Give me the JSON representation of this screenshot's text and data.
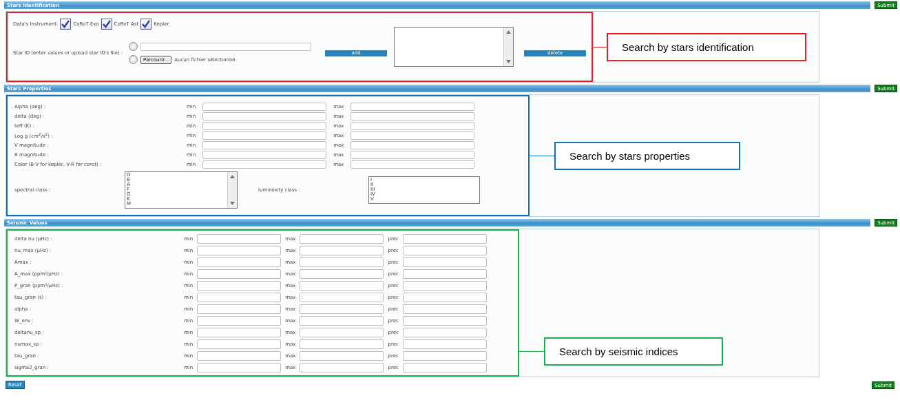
{
  "identification": {
    "title": "Stars Identification",
    "submit": "Submit",
    "instrument_label": "Data's Instrument:",
    "instruments": [
      {
        "label": "CoRoT Exo",
        "checked": true
      },
      {
        "label": "CoRoT Ast",
        "checked": true
      },
      {
        "label": "Kepler",
        "checked": true
      }
    ],
    "star_id_label": "Star ID (enter values or upload star ID's file) :",
    "options": [
      {
        "kind": "text",
        "selected": false
      },
      {
        "kind": "file",
        "selected": false,
        "browse": "Parcourir...",
        "file_status": "Aucun fichier sélectionné."
      }
    ],
    "add": "add",
    "delete": "delete",
    "annotation": {
      "text": "Search by stars identification",
      "color": "#ee1c1c"
    }
  },
  "properties": {
    "title": "Stars Properties",
    "submit": "Submit",
    "rows": [
      {
        "label": "Alpha (deg) :",
        "min": "min",
        "max": "max"
      },
      {
        "label": "delta (deg) :",
        "min": "min",
        "max": "max"
      },
      {
        "label": "teff (K) :",
        "min": "min",
        "max": "max"
      },
      {
        "label": "Log g (cm$^{2}$/s$^{2}$) :",
        "min": "min",
        "max": "max"
      },
      {
        "label": "V magnitude :",
        "min": "min",
        "max": "max"
      },
      {
        "label": "R magnitude :",
        "min": "min",
        "max": "max"
      },
      {
        "label": "Color (B-V for kepler, V-R for corot) :",
        "min": "min",
        "max": "max"
      }
    ],
    "spectral_label": "spectral class :",
    "spectral_options": [
      "O",
      "B",
      "A",
      "F",
      "G",
      "K",
      "M"
    ],
    "luminosity_label": "luminosity class :",
    "luminosity_options": [
      "I",
      "II",
      "III",
      "IV",
      "V"
    ],
    "annotation": {
      "text": "Search by stars properties",
      "color": "#1070c0"
    }
  },
  "seismic": {
    "title": "Seismic Values",
    "submit": "Submit",
    "rows": [
      {
        "label": "delta nu (µHz) :",
        "min": "min",
        "max": "max",
        "prec": "prec"
      },
      {
        "label": "nu_max (µHz) :",
        "min": "min",
        "max": "max",
        "prec": "prec"
      },
      {
        "label": "Amax :",
        "min": "min",
        "max": "max",
        "prec": "prec"
      },
      {
        "label": "A_max (ppm²/µHz) :",
        "min": "min",
        "max": "max",
        "prec": "prec"
      },
      {
        "label": "P_gran (ppm²/µHz) :",
        "min": "min",
        "max": "max",
        "prec": "prec"
      },
      {
        "label": "tau_gran (s) :",
        "min": "min",
        "max": "max",
        "prec": "prec"
      },
      {
        "label": "alpha :",
        "min": "min",
        "max": "max",
        "prec": "prec"
      },
      {
        "label": "W_env :",
        "min": "min",
        "max": "max",
        "prec": "prec"
      },
      {
        "label": "deltanu_sp :",
        "min": "min",
        "max": "max",
        "prec": "prec"
      },
      {
        "label": "numax_sp :",
        "min": "min",
        "max": "max",
        "prec": "prec"
      },
      {
        "label": "tau_gran :",
        "min": "min",
        "max": "max",
        "prec": "prec"
      },
      {
        "label": "sigma2_gran :",
        "min": "min",
        "max": "max",
        "prec": "prec"
      }
    ],
    "annotation": {
      "text": "Search by seismic indices",
      "color": "#1db04c"
    }
  },
  "footer": {
    "reset": "Reset",
    "submit": "Submit"
  }
}
